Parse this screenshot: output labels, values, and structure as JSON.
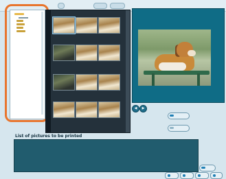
{
  "list": {
    "label": "List of pictures to be printed"
  }
}
